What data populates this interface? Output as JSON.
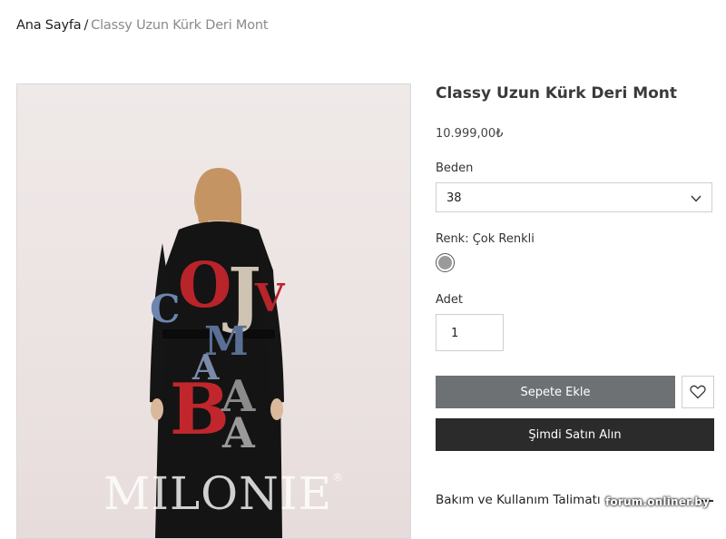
{
  "breadcrumb": {
    "home": "Ana Sayfa",
    "separator": "/",
    "current": "Classy Uzun Kürk Deri Mont"
  },
  "product": {
    "title": "Classy Uzun Kürk Deri Mont",
    "price": "10.999,00₺",
    "image_watermark": "MILONIE",
    "image_watermark_mark": "®"
  },
  "size": {
    "label": "Beden",
    "selected": "38"
  },
  "color": {
    "label": "Renk: Çok Renkli",
    "swatch_color": "#9a9a9a"
  },
  "quantity": {
    "label": "Adet",
    "value": "1"
  },
  "actions": {
    "add_to_cart": "Sepete Ekle",
    "buy_now": "Şimdi Satın Alın"
  },
  "care": {
    "title": "Bakım ve Kullanım Talimatı"
  },
  "overlay_watermark": "forum.onliner.by",
  "colors": {
    "cart_button": "#6e7174",
    "buy_button": "#2b2b2b"
  }
}
